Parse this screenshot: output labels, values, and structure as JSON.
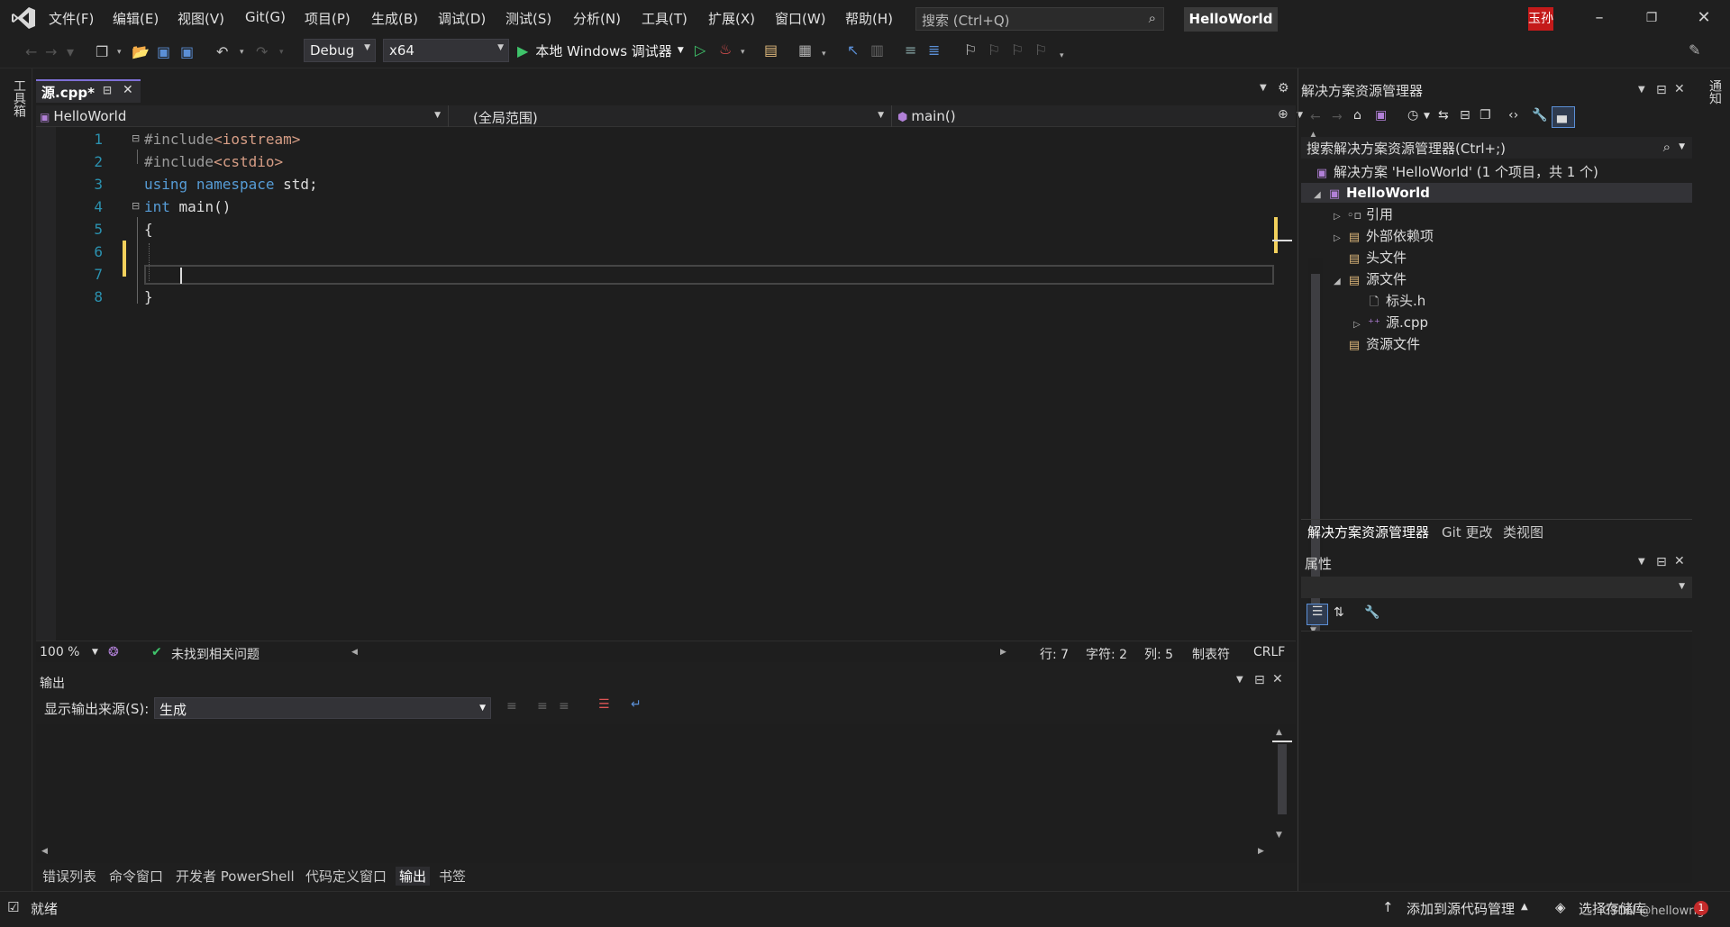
{
  "menu": [
    "文件(F)",
    "编辑(E)",
    "视图(V)",
    "Git(G)",
    "项目(P)",
    "生成(B)",
    "调试(D)",
    "测试(S)",
    "分析(N)",
    "工具(T)",
    "扩展(X)",
    "窗口(W)",
    "帮助(H)"
  ],
  "search": {
    "placeholder": "搜索 (Ctrl+Q)"
  },
  "project_title": "HelloWorld",
  "user_badge": "玉孙",
  "toolbar": {
    "config": "Debug",
    "platform": "x64",
    "run_label": "本地 Windows 调试器"
  },
  "left_strip_label": "工具箱",
  "right_strip_label": "通知",
  "editor": {
    "tab_name": "源.cpp*",
    "nav_project": "HelloWorld",
    "nav_scope": "(全局范围)",
    "nav_member": "main()",
    "line_numbers": [
      "1",
      "2",
      "3",
      "4",
      "5",
      "6",
      "7",
      "8"
    ],
    "code": {
      "l1a": "#include",
      "l1b": "<iostream>",
      "l2a": "#include",
      "l2b": "<cstdio>",
      "l3a": "using",
      "l3b": "namespace",
      "l3c": " std;",
      "l4a": "int",
      "l4b": " main()",
      "l5": "{",
      "l8": "}"
    },
    "status": {
      "zoom": "100 %",
      "issues": "未找到相关问题",
      "line": "行: 7",
      "char": "字符: 2",
      "col": "列: 5",
      "indent": "制表符",
      "eol": "CRLF"
    }
  },
  "output": {
    "title": "输出",
    "source_label": "显示输出来源(S):",
    "source_value": "生成"
  },
  "bottom_tabs": [
    "错误列表",
    "命令窗口",
    "开发者 PowerShell",
    "代码定义窗口",
    "输出",
    "书签"
  ],
  "solution": {
    "title": "解决方案资源管理器",
    "search_placeholder": "搜索解决方案资源管理器(Ctrl+;)",
    "nodes": {
      "solution": "解决方案 'HelloWorld' (1 个项目，共 1 个)",
      "project": "HelloWorld",
      "refs": "引用",
      "external": "外部依赖项",
      "headers": "头文件",
      "sources": "源文件",
      "header_file": "标头.h",
      "source_file": "源.cpp",
      "resources": "资源文件"
    },
    "tabs": [
      "解决方案资源管理器",
      "Git 更改",
      "类视图"
    ]
  },
  "properties": {
    "title": "属性"
  },
  "statusbar": {
    "ready": "就绪",
    "add_source": "添加到源代码管理",
    "select_repo": "选择存储库",
    "watermark": "CSDN @hellowrlg"
  }
}
